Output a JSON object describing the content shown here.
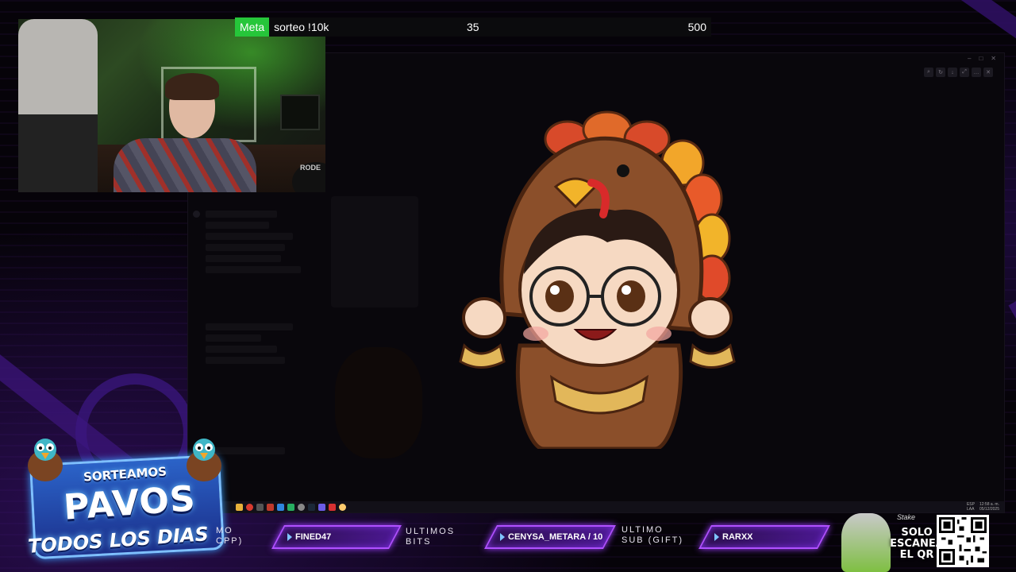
{
  "stream": {
    "goal": {
      "tag": "Meta",
      "text": "sorteo !10k",
      "current": "35",
      "target": "500"
    },
    "webcam": {
      "mic_brand": "RODE"
    },
    "promo": {
      "line1": "SORTEAMOS",
      "line2": "PAVOS",
      "line3": "TODOS LOS DIAS"
    },
    "alerts": {
      "frag1": "MO",
      "frag2": "CPP)",
      "follower": "FINED47",
      "bits_label_1": "ULTIMOS",
      "bits_label_2": "BITS",
      "bits_value": "CENYSA_METARA / 10",
      "sub_label_1": "ULTIMO",
      "sub_label_2": "SUB (GIFT)",
      "sub_value": "RARXX"
    },
    "sponsor": {
      "brand": "Stake",
      "line1": "SOLO",
      "line2": "ESCANEA",
      "line3": "EL QR"
    }
  },
  "desktop": {
    "taskbar_lang": "ESP",
    "taskbar_region": "LAA",
    "taskbar_time": "12:58 a. m.",
    "taskbar_date": "05/12/2025"
  },
  "colors": {
    "goal_tag": "#26c63a",
    "alert_border": "#b050ff",
    "alert_fill": "#4b1890",
    "promo_blue": "#2b63c8"
  },
  "icons": [
    "play-icon",
    "turkey-emote",
    "qr-code",
    "window-close-icon",
    "window-maximize-icon",
    "window-minimize-icon"
  ]
}
